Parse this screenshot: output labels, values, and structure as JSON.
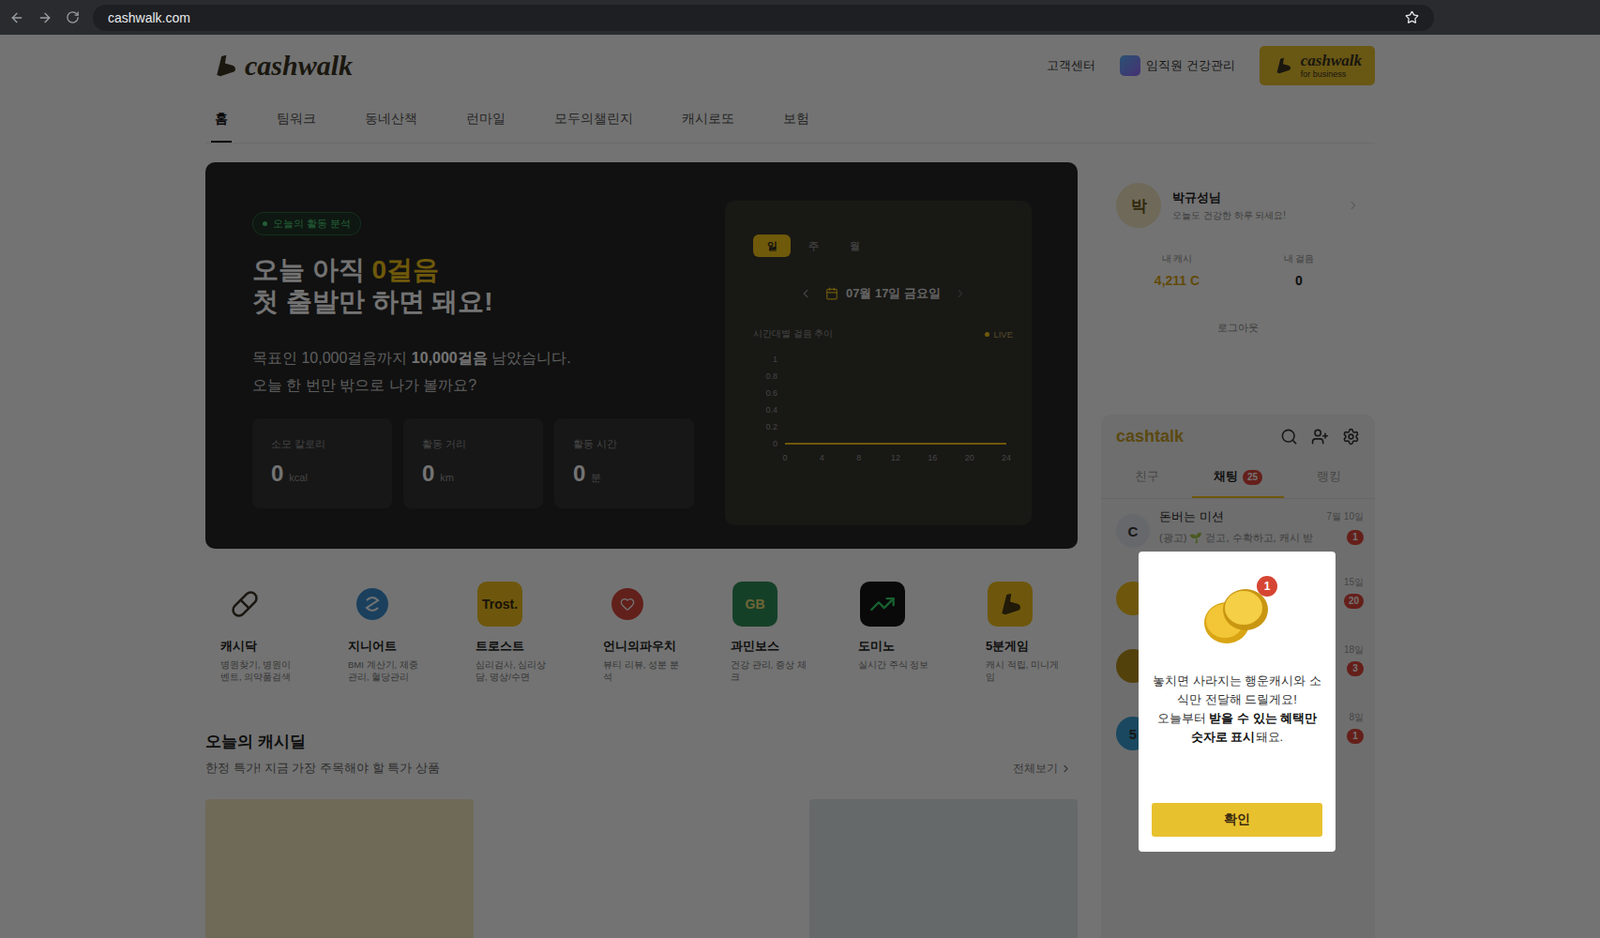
{
  "browser": {
    "url": "cashwalk.com"
  },
  "header": {
    "logo": "cashwalk",
    "links": [
      "고객센터",
      "임직원 건강관리"
    ],
    "business_button": {
      "logo": "cashwalk",
      "sub": "for business"
    }
  },
  "nav": [
    {
      "label": "홈",
      "selected": true
    },
    {
      "label": "팀워크",
      "selected": false
    },
    {
      "label": "동네산책",
      "selected": false
    },
    {
      "label": "런마일",
      "selected": false
    },
    {
      "label": "모두의챌린지",
      "selected": false
    },
    {
      "label": "캐시로또",
      "selected": false
    },
    {
      "label": "보험",
      "selected": false
    }
  ],
  "hero": {
    "badge": "오늘의 활동 분석",
    "title": [
      {
        "text": "오늘 아직 ",
        "highlight": false
      },
      {
        "text": "0걸음",
        "highlight": true
      }
    ],
    "title2": "첫 출발만 하면 돼요!",
    "description": [
      [
        {
          "text": "목표인 10,000걸음까지 ",
          "bold": false
        },
        {
          "text": "10,000걸음",
          "bold": true
        },
        {
          "text": " 남았습니다.",
          "bold": false
        }
      ],
      [
        {
          "text": "오늘 한 번만 밖으로 나가 볼까요?",
          "bold": false
        }
      ]
    ],
    "stats": [
      {
        "label": "소모 칼로리",
        "value": "0",
        "unit": "kcal"
      },
      {
        "label": "활동 거리",
        "value": "0",
        "unit": "km"
      },
      {
        "label": "활동 시간",
        "value": "0",
        "unit": "분"
      }
    ]
  },
  "chart": {
    "periods": [
      {
        "label": "일",
        "selected": true
      },
      {
        "label": "주",
        "selected": false
      },
      {
        "label": "월",
        "selected": false
      }
    ],
    "date": "07월 17일 금요일",
    "title": "시간대별 걸음 추이",
    "live": "LIVE",
    "y_ticks": [
      "1",
      "0.8",
      "0.6",
      "0.4",
      "0.2",
      "0"
    ],
    "x_ticks": [
      "0",
      "4",
      "8",
      "12",
      "16",
      "20",
      "24"
    ],
    "values": [
      0,
      0,
      0,
      0,
      0,
      0,
      0,
      0,
      0,
      0,
      0,
      0,
      0,
      0,
      0,
      0,
      0,
      0,
      0,
      0,
      0,
      0,
      0,
      0,
      0
    ]
  },
  "user": {
    "avatar": "박",
    "name": "박규성님",
    "greeting": "오늘도 건강한 하루 되세요!",
    "stats": [
      {
        "label": "내 캐시",
        "value": "4,211 C"
      },
      {
        "label": "내 걸음",
        "value": "0"
      }
    ],
    "logout": "로그아웃"
  },
  "cashtalk": {
    "logo": "cashtalk",
    "tabs": [
      {
        "label": "친구",
        "badge": "",
        "selected": false
      },
      {
        "label": "채팅",
        "badge": "25",
        "selected": true
      },
      {
        "label": "랭킹",
        "badge": "",
        "selected": false
      }
    ],
    "chats": [
      {
        "name": "돈버는 미션",
        "preview": "(광고) 🌱 걷고, 수확하고, 캐시 받",
        "date": "7월 10일",
        "badge": "1",
        "avatar": "C",
        "color": "#e4e6f0"
      },
      {
        "name": "",
        "preview": "",
        "date": "15일",
        "badge": "20",
        "avatar": "",
        "color": "#f4c21c"
      },
      {
        "name": "",
        "preview": "",
        "date": "18일",
        "badge": "3",
        "avatar": "",
        "color": "#b8901c"
      },
      {
        "name": "",
        "preview": "",
        "date": "8일",
        "badge": "1",
        "avatar": "5",
        "color": "#3a9fd6"
      }
    ]
  },
  "popup": {
    "badge": "1",
    "lines": [
      [
        {
          "text": "놓치면 사라지는 행운캐시와 소식만 전달해 드릴게요!",
          "bold": false
        }
      ],
      [
        {
          "text": "오늘부터 ",
          "bold": false
        },
        {
          "text": "받을 수 있는 혜택만",
          "bold": true
        },
        {
          "text": " ",
          "bold": false
        },
        {
          "text": "숫자로 표시",
          "bold": true
        },
        {
          "text": "돼요.",
          "bold": false
        }
      ]
    ],
    "button": "확인"
  },
  "apps": [
    {
      "name": "캐시닥",
      "desc": "병원찾기, 병원이벤트, 의약품검색",
      "logo": "",
      "kind": "pill",
      "color": "#ffffff"
    },
    {
      "name": "지니어트",
      "desc": "BMI 계산기, 체중관리, 혈당관리",
      "logo": "",
      "kind": "swirl",
      "color": "#ffffff"
    },
    {
      "name": "트로스트",
      "desc": "심리검사, 심리상담, 명상/수면",
      "logo": "Trost.",
      "kind": "text",
      "color": "#f4c21c"
    },
    {
      "name": "언니의파우치",
      "desc": "뷰티 리뷰, 성분 분석",
      "logo": "",
      "kind": "pouch",
      "color": "#ffffff"
    },
    {
      "name": "과민보스",
      "desc": "건강 관리, 증상 체크",
      "logo": "GB",
      "kind": "text",
      "color": "#2f8f5a"
    },
    {
      "name": "도미노",
      "desc": "실시간 주식 정보",
      "logo": "",
      "kind": "chart",
      "color": "#141414"
    },
    {
      "name": "5분게임",
      "desc": "캐시 적립, 미니게임",
      "logo": "",
      "kind": "shoe",
      "color": "#f4c21c"
    }
  ],
  "deal": {
    "title": "오늘의 캐시딜",
    "subtitle": "한정 특가! 지금 가장 주목해야 할 특가 상품",
    "more": "전체보기",
    "products": [
      {
        "color": "#f6ecc4"
      },
      {
        "color": "#ffffff"
      },
      {
        "color": "#dfe8ea"
      }
    ]
  }
}
